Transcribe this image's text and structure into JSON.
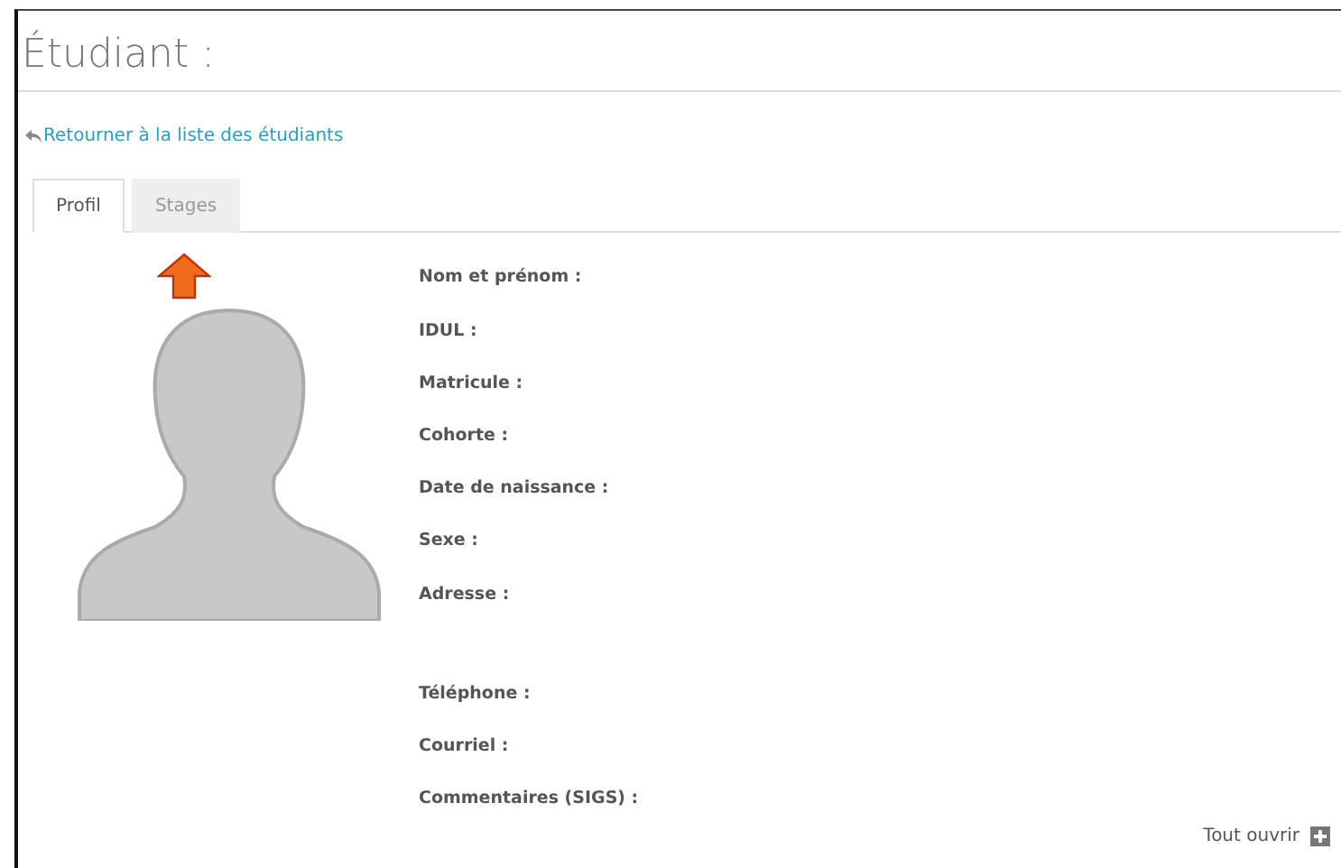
{
  "title": "Étudiant :",
  "back_link": "Retourner à la liste des étudiants",
  "tabs": [
    {
      "label": "Profil",
      "selected": true
    },
    {
      "label": "Stages",
      "selected": false
    }
  ],
  "fields": [
    {
      "label": "Nom et prénom :",
      "kind": "line"
    },
    {
      "label": "IDUL :",
      "kind": "line"
    },
    {
      "label": "Matricule :",
      "kind": "line"
    },
    {
      "label": "Cohorte :",
      "kind": "line"
    },
    {
      "label": "Date de naissance :",
      "kind": "line"
    },
    {
      "label": "Sexe :",
      "kind": "line"
    },
    {
      "label": "Adresse :",
      "kind": "block"
    },
    {
      "label": "Téléphone :",
      "kind": "line"
    },
    {
      "label": "Courriel :",
      "kind": "line"
    },
    {
      "label": "Commentaires (SIGS) :",
      "kind": "line"
    }
  ],
  "expand_all": "Tout ouvrir"
}
